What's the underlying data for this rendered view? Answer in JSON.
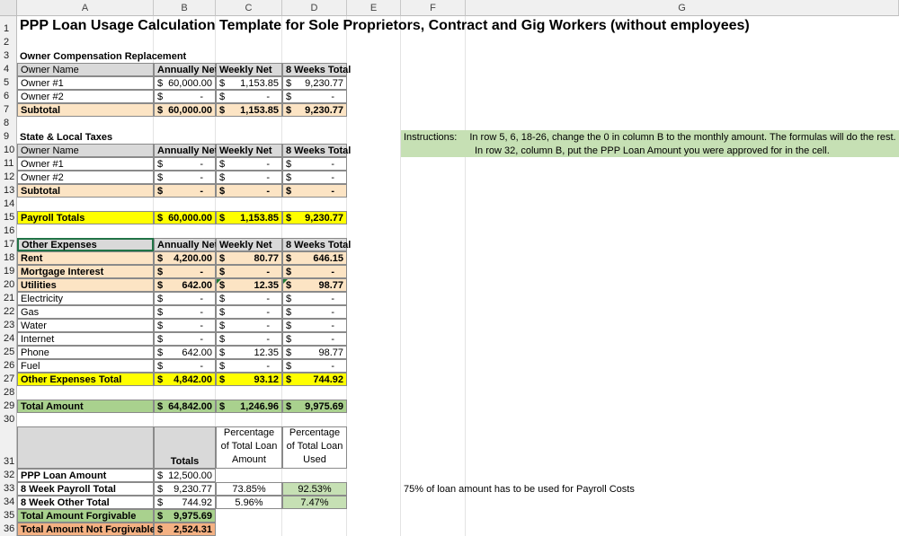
{
  "columns": [
    "A",
    "B",
    "C",
    "D",
    "E",
    "F",
    "G"
  ],
  "rows": [
    "1",
    "2",
    "3",
    "4",
    "5",
    "6",
    "7",
    "8",
    "9",
    "10",
    "11",
    "12",
    "13",
    "14",
    "15",
    "16",
    "17",
    "18",
    "19",
    "20",
    "21",
    "22",
    "23",
    "24",
    "25",
    "26",
    "27",
    "28",
    "29",
    "30",
    "31",
    "32",
    "33",
    "34",
    "35",
    "36"
  ],
  "title": "PPP Loan Usage Calculation Template for Sole Proprietors, Contract and Gig Workers (without employees)",
  "headers": {
    "annually": "Annually Net",
    "weekly": "Weekly Net",
    "eight": "8 Weeks Total"
  },
  "owner_comp": {
    "section": "Owner Compensation Replacement",
    "col_label": "Owner Name",
    "rows": [
      {
        "label": "Owner  #1",
        "b": "60,000.00",
        "c": "1,153.85",
        "d": "9,230.77"
      },
      {
        "label": "Owner #2",
        "b": "-",
        "c": "-",
        "d": "-"
      }
    ],
    "subtotal": {
      "label": "Subtotal",
      "b": "60,000.00",
      "c": "1,153.85",
      "d": "9,230.77"
    }
  },
  "taxes": {
    "section": "State & Local Taxes",
    "col_label": "Owner Name",
    "rows": [
      {
        "label": "Owner  #1",
        "b": "-",
        "c": "-",
        "d": "-"
      },
      {
        "label": "Owner #2",
        "b": "-",
        "c": "-",
        "d": "-"
      }
    ],
    "subtotal": {
      "label": "Subtotal",
      "b": "-",
      "c": "-",
      "d": "-"
    }
  },
  "payroll_totals": {
    "label": "Payroll Totals",
    "b": "60,000.00",
    "c": "1,153.85",
    "d": "9,230.77"
  },
  "other": {
    "section": "Other Expenses",
    "rows": [
      {
        "label": "Rent",
        "b": "4,200.00",
        "c": "80.77",
        "d": "646.15",
        "bold": true
      },
      {
        "label": "Mortgage Interest",
        "b": "-",
        "c": "-",
        "d": "-",
        "bold": true
      },
      {
        "label": "Utilities",
        "b": "642.00",
        "c": "12.35",
        "d": "98.77",
        "bold": true
      },
      {
        "label": "Electricity",
        "b": "-",
        "c": "-",
        "d": "-"
      },
      {
        "label": "Gas",
        "b": "-",
        "c": "-",
        "d": "-"
      },
      {
        "label": "Water",
        "b": "-",
        "c": "-",
        "d": "-"
      },
      {
        "label": "Internet",
        "b": "-",
        "c": "-",
        "d": "-"
      },
      {
        "label": "Phone",
        "b": "642.00",
        "c": "12.35",
        "d": "98.77"
      },
      {
        "label": "Fuel",
        "b": "-",
        "c": "-",
        "d": "-"
      }
    ],
    "total": {
      "label": "Other Expenses Total",
      "b": "4,842.00",
      "c": "93.12",
      "d": "744.92"
    }
  },
  "total_amount": {
    "label": "Total Amount",
    "b": "64,842.00",
    "c": "1,246.96",
    "d": "9,975.69"
  },
  "summary": {
    "h_totals": "Totals",
    "h_pct_loan": "Percentage of Total Loan Amount",
    "h_pct_used": "Percentage of Total Loan Used",
    "rows": [
      {
        "label": "PPP Loan Amount",
        "b": "12,500.00",
        "c": "",
        "d": ""
      },
      {
        "label": "8 Week Payroll Total",
        "b": "9,230.77",
        "c": "73.85%",
        "d": "92.53%"
      },
      {
        "label": "8 Week Other Total",
        "b": "744.92",
        "c": "5.96%",
        "d": "7.47%"
      }
    ],
    "forgivable": {
      "label": "Total Amount Forgivable",
      "b": "9,975.69"
    },
    "not_forgivable": {
      "label": "Total Amount Not Forgivable",
      "b": "2,524.31"
    }
  },
  "currency": "$",
  "instructions": {
    "label": "Instructions:",
    "line1": "In row 5, 6, 18-26, change the 0 in column B to the monthly amount. The formulas will do the rest.",
    "line2": "In row 32, column B, put the PPP Loan Amount you were approved for in the cell."
  },
  "note_payroll": "75% of loan amount has to be used for Payroll Costs",
  "colors": {
    "gray": "#d9d9d9",
    "peach": "#fce4c4",
    "yellow": "#ffff00",
    "green": "#a9d18e",
    "light_green": "#c6e0b4",
    "salmon": "#f4b183"
  }
}
